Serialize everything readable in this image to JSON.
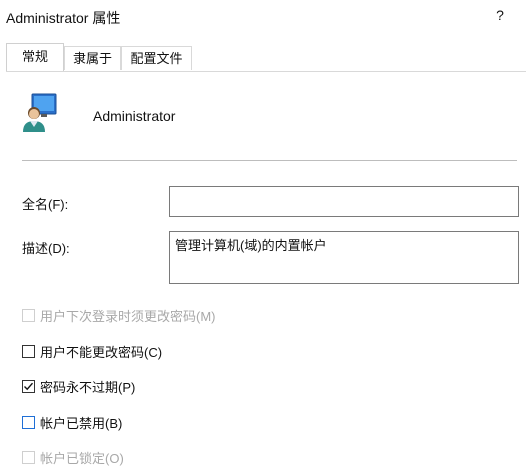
{
  "window": {
    "title": "Administrator 属性",
    "help_label": "?"
  },
  "tabs": [
    {
      "label": "常规",
      "active": true
    },
    {
      "label": "隶属于",
      "active": false
    },
    {
      "label": "配置文件",
      "active": false
    }
  ],
  "user": {
    "icon": "user-account-icon",
    "name": "Administrator"
  },
  "fields": {
    "fullname_label": "全名(F):",
    "fullname_value": "",
    "description_label": "描述(D):",
    "description_value": "管理计算机(域)的内置帐户"
  },
  "options": [
    {
      "label": "用户下次登录时须更改密码(M)",
      "checked": false,
      "enabled": false
    },
    {
      "label": "用户不能更改密码(C)",
      "checked": false,
      "enabled": true
    },
    {
      "label": "密码永不过期(P)",
      "checked": true,
      "enabled": true
    },
    {
      "label": "帐户已禁用(B)",
      "checked": false,
      "enabled": true
    },
    {
      "label": "帐户已锁定(O)",
      "checked": false,
      "enabled": false
    }
  ],
  "colors": {
    "accent": "#1f6fd6",
    "disabled_text": "#a8a8a8"
  }
}
